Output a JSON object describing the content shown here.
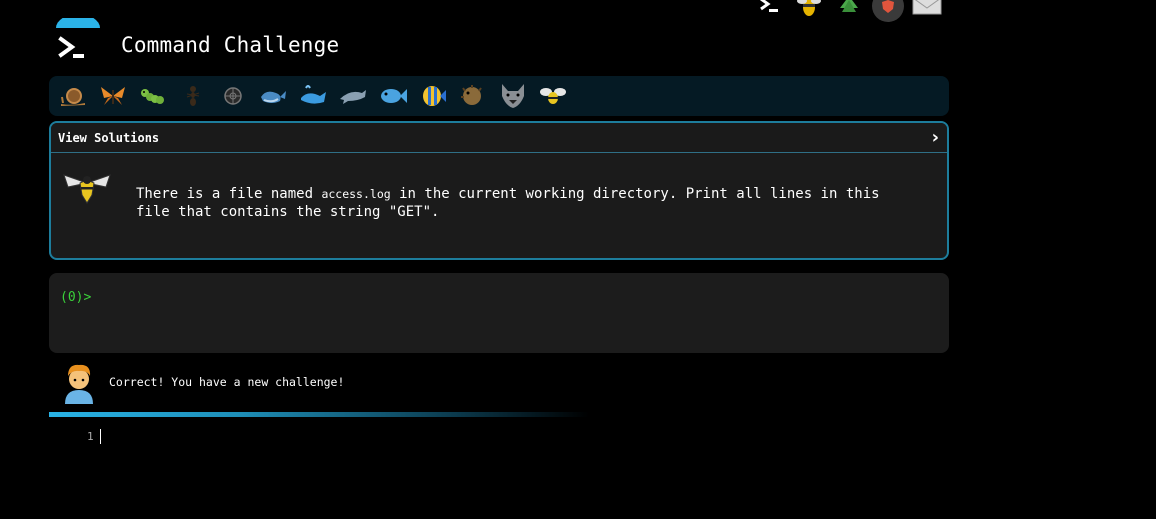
{
  "app": {
    "title": "Command Challenge"
  },
  "top_icons": [
    {
      "name": "terminal-icon",
      "glyph": "≥"
    },
    {
      "name": "bee-badge-icon",
      "glyph": "🐝"
    },
    {
      "name": "tree-icon",
      "glyph": "🌲"
    },
    {
      "name": "shield-icon",
      "glyph": "🛡"
    },
    {
      "name": "mail-icon",
      "glyph": "✉"
    }
  ],
  "creatures": [
    {
      "name": "snail-icon",
      "glyph": "🐌"
    },
    {
      "name": "butterfly-icon",
      "glyph": "🦋"
    },
    {
      "name": "caterpillar-icon",
      "glyph": "🐛"
    },
    {
      "name": "ant-icon",
      "glyph": "🐜"
    },
    {
      "name": "ladybug-icon",
      "glyph": "❂"
    },
    {
      "name": "whale-icon",
      "glyph": "🐋"
    },
    {
      "name": "spouting-whale-icon",
      "glyph": "🐳"
    },
    {
      "name": "dolphin-icon",
      "glyph": "🐬"
    },
    {
      "name": "fish-icon",
      "glyph": "🐟"
    },
    {
      "name": "tropical-fish-icon",
      "glyph": "🐠"
    },
    {
      "name": "blowfish-icon",
      "glyph": "🐡"
    },
    {
      "name": "wolf-icon",
      "glyph": "🐺"
    },
    {
      "name": "bee-icon",
      "glyph": "🐝"
    }
  ],
  "solutions": {
    "label": "View Solutions",
    "chevron": "›"
  },
  "challenge": {
    "text_before": "There is a file named ",
    "filename": "access.log",
    "text_after": " in the current working directory. Print all lines in this file that contains the string \"GET\"."
  },
  "terminal": {
    "prompt": "(0)>"
  },
  "feedback": {
    "message": "Correct! You have a new challenge!"
  },
  "progress": {
    "fraction": 0.6
  },
  "editor": {
    "line_number": "1"
  },
  "colors": {
    "accent": "#1d7d9c",
    "prompt_green": "#3ad13a",
    "bar_bg": "#051a24"
  }
}
